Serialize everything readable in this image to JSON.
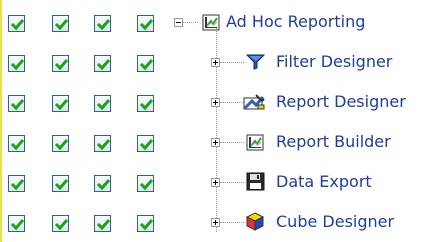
{
  "tree": {
    "root": {
      "label": "Ad Hoc Reporting",
      "icon": "report-chart-icon",
      "expanded": true
    },
    "children": [
      {
        "label": "Filter Designer",
        "icon": "funnel-icon"
      },
      {
        "label": "Report Designer",
        "icon": "report-designer-icon"
      },
      {
        "label": "Report Builder",
        "icon": "report-builder-icon"
      },
      {
        "label": "Data Export",
        "icon": "floppy-disk-icon"
      },
      {
        "label": "Cube Designer",
        "icon": "cube-icon"
      }
    ]
  },
  "permissions": {
    "columns": 4,
    "rows": [
      [
        true,
        true,
        true,
        true
      ],
      [
        true,
        true,
        true,
        true
      ],
      [
        true,
        true,
        true,
        true
      ],
      [
        true,
        true,
        true,
        true
      ],
      [
        true,
        true,
        true,
        true
      ],
      [
        true,
        true,
        true,
        true
      ]
    ]
  },
  "colors": {
    "label": "#1f3ca0",
    "checkbox_border": "#2f5f98",
    "checkmark": "#17a51c",
    "tree_lines": "#9a9a9a",
    "left_strip": "#e9e24a"
  }
}
